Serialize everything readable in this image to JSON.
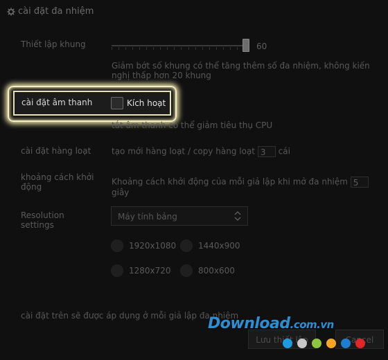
{
  "window": {
    "title": "cài đặt đa nhiệm"
  },
  "frame": {
    "label": "Thiết lập khung",
    "value": "60",
    "hint": "Giảm bớt số khung có thể tăng thêm số đa nhiệm, không kiến nghị thấp hơn 20 khung"
  },
  "sound": {
    "label": "cài đặt âm thanh",
    "checkbox_label": "Kích hoạt",
    "hint": "tắt âm thanh có thể giảm tiêu thụ CPU"
  },
  "batch": {
    "label": "cài đặt hàng loạt",
    "text_before": "tạo mới hàng loạt / copy hàng loạt",
    "value": "3",
    "text_after": "cái"
  },
  "interval": {
    "label": "khoảng cách khởi động",
    "text_before": "Khoảng cách khởi động của mỗi giả lập khi mở đa nhiệm",
    "value": "5",
    "text_after": "giây"
  },
  "resolution": {
    "label": "Resolution settings",
    "select_value": "Máy tính bảng",
    "options": [
      "1920x1080",
      "1440x900",
      "1280x720",
      "800x600"
    ]
  },
  "footer": {
    "note": "cài đặt trên sẽ được áp dụng ở mỗi giả lập đa nhiệm"
  },
  "buttons": {
    "save": "Lưu thiết lập",
    "cancel": "Cancel"
  },
  "watermark": {
    "text": "Download",
    "suffix": ".com.vn",
    "dot_colors": [
      "#1e9be0",
      "#c8c8c8",
      "#8ec63f",
      "#f6a623",
      "#1e7fd0",
      "#e0252b"
    ]
  }
}
